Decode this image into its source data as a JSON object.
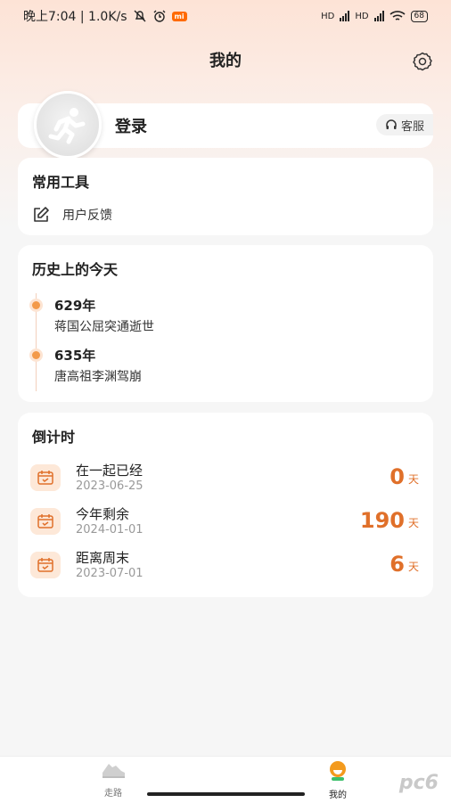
{
  "status_bar": {
    "time_speed": "晚上7:04 | 1.0K/s",
    "mi_badge": "mi",
    "hd1": "HD",
    "hd2": "HD",
    "battery": "68"
  },
  "header": {
    "title": "我的"
  },
  "profile": {
    "login_label": "登录",
    "service_label": "客服"
  },
  "tools": {
    "title": "常用工具",
    "feedback_label": "用户反馈"
  },
  "history": {
    "title": "历史上的今天",
    "events": [
      {
        "year": "629年",
        "desc": "蒋国公屈突通逝世"
      },
      {
        "year": "635年",
        "desc": "唐高祖李渊驾崩"
      }
    ]
  },
  "countdown": {
    "title": "倒计时",
    "items": [
      {
        "name": "在一起已经",
        "date": "2023-06-25",
        "value": "0",
        "unit": "天"
      },
      {
        "name": "今年剩余",
        "date": "2024-01-01",
        "value": "190",
        "unit": "天"
      },
      {
        "name": "距离周末",
        "date": "2023-07-01",
        "value": "6",
        "unit": "天"
      }
    ]
  },
  "bottom_nav": {
    "walk_label": "走路",
    "mine_label": "我的"
  },
  "watermark": "pc6",
  "colors": {
    "accent": "#e0702a",
    "timeline_dot": "#f39a4a",
    "icon_bg": "#fde8d8"
  }
}
